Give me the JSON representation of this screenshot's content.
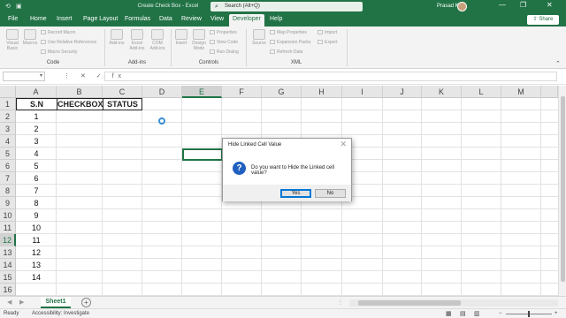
{
  "window": {
    "title": "Create Check Box  -  Excel",
    "search_placeholder": "Search (Alt+Q)",
    "user": "Prasad K",
    "minimize": "—",
    "restore": "❐",
    "close": "✕",
    "qat_autosave": "⟲",
    "qat_save": "💾"
  },
  "menu": {
    "tabs": [
      "File",
      "Home",
      "Insert",
      "Page Layout",
      "Formulas",
      "Data",
      "Review",
      "View",
      "Developer",
      "Help"
    ],
    "active_tab": "Developer",
    "share": "Share"
  },
  "ribbon": {
    "code": {
      "label": "Code",
      "visual_basic": "Visual Basic",
      "macros": "Macros",
      "record_macro": "Record Macro",
      "relative_refs": "Use Relative References",
      "macro_security": "Macro Security"
    },
    "addins": {
      "label": "Add-ins",
      "addins": "Add-ins",
      "excel_addins": "Excel Add-ins",
      "com_addins": "COM Add-ins"
    },
    "controls": {
      "label": "Controls",
      "insert": "Insert",
      "design_mode": "Design Mode",
      "properties": "Properties",
      "view_code": "View Code",
      "run_dialog": "Run Dialog"
    },
    "xml": {
      "label": "XML",
      "source": "Source",
      "map_properties": "Map Properties",
      "expansion_packs": "Expansion Packs",
      "refresh_data": "Refresh Data",
      "import": "Import",
      "export": "Export"
    }
  },
  "formula_bar": {
    "name_box": "",
    "icons": "⋮ ✕ ✓ fx",
    "content": ""
  },
  "sheet": {
    "columns": [
      "A",
      "B",
      "C",
      "D",
      "E",
      "F",
      "G",
      "H",
      "I",
      "J",
      "K",
      "L",
      "M"
    ],
    "rows": [
      "1",
      "2",
      "3",
      "4",
      "5",
      "6",
      "7",
      "8",
      "9",
      "10",
      "11",
      "12",
      "13",
      "14",
      "15",
      "16"
    ],
    "selected_column": "E",
    "selected_row": "12",
    "headers": {
      "a1": "S.N",
      "b1": "CHECKBOX",
      "c1": "STATUS"
    },
    "sn_values": [
      "1",
      "2",
      "3",
      "4",
      "5",
      "6",
      "7",
      "8",
      "9",
      "10",
      "11",
      "12",
      "13",
      "14"
    ]
  },
  "sheet_tabs": {
    "nav_prev": "◀",
    "nav_next": "▶",
    "active": "Sheet1",
    "add": "+"
  },
  "status_bar": {
    "ready": "Ready",
    "accessibility": "Accessibility: Investigate"
  },
  "dialog": {
    "title": "Hide Linked Cell Value",
    "message": "Do you want to Hide the Linked cell value?",
    "icon": "?",
    "yes": "Yes",
    "no": "No",
    "close": "✕"
  }
}
